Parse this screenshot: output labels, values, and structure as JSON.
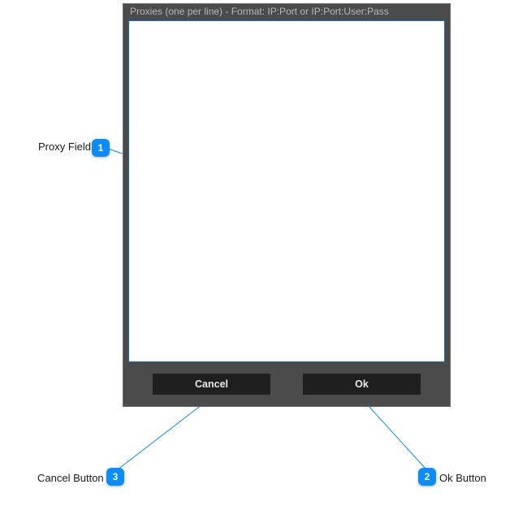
{
  "dialog": {
    "title": "Proxies (one per line) - Format: IP:Port or IP:Port:User:Pass",
    "proxy_value": "",
    "proxy_placeholder": "",
    "buttons": {
      "cancel": "Cancel",
      "ok": "Ok"
    }
  },
  "annotations": {
    "a1": {
      "num": "1",
      "label": "Proxy Field"
    },
    "a2": {
      "num": "2",
      "label": "Ok Button"
    },
    "a3": {
      "num": "3",
      "label": "Cancel Button"
    }
  }
}
